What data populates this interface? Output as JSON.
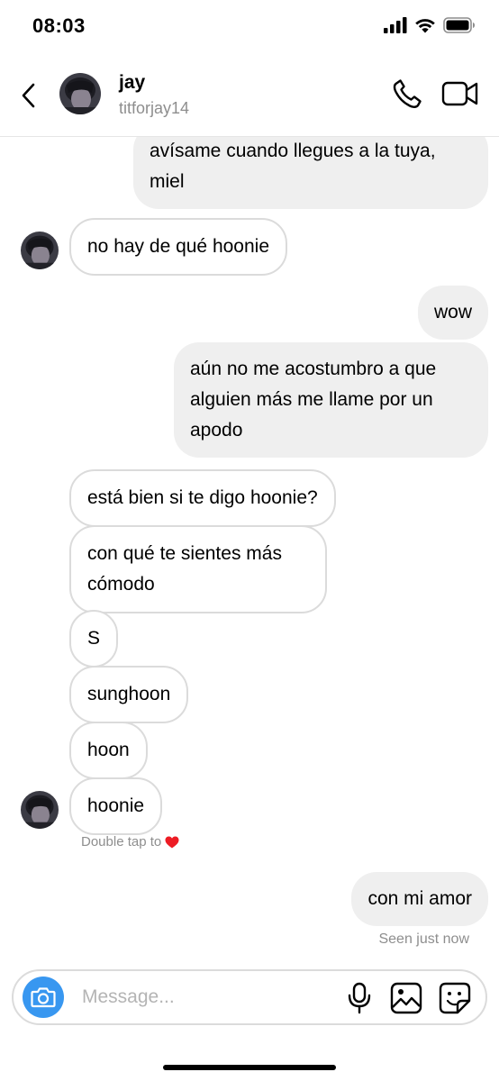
{
  "status_bar": {
    "time": "08:03"
  },
  "header": {
    "name": "jay",
    "handle": "titforjay14"
  },
  "messages": [
    {
      "direction": "outgoing",
      "text": "avísame cuando llegues a la tuya, miel"
    },
    {
      "direction": "incoming",
      "text": "no hay de qué hoonie"
    },
    {
      "direction": "outgoing",
      "text": "wow"
    },
    {
      "direction": "outgoing",
      "text": "aún no me acostumbro a que alguien más me llame por un apodo"
    },
    {
      "direction": "incoming",
      "text": "está bien si te digo hoonie?"
    },
    {
      "direction": "incoming",
      "text": "con qué te sientes más cómodo"
    },
    {
      "direction": "incoming",
      "text": "S"
    },
    {
      "direction": "incoming",
      "text": "sunghoon"
    },
    {
      "direction": "incoming",
      "text": "hoon"
    },
    {
      "direction": "incoming",
      "text": "hoonie"
    },
    {
      "direction": "outgoing",
      "text": "con mi amor"
    }
  ],
  "double_tap_hint": "Double tap to",
  "seen_status": "Seen just now",
  "composer": {
    "placeholder": "Message..."
  },
  "colors": {
    "accent": "#3897f0",
    "outgoing_bubble": "#efefef",
    "incoming_border": "#dbdbdb",
    "secondary_text": "#8e8e8e",
    "heart": "#ed1c24"
  },
  "icons": [
    "back-arrow-icon",
    "phone-icon",
    "video-camera-icon",
    "camera-icon",
    "microphone-icon",
    "gallery-icon",
    "sticker-icon",
    "heart-icon",
    "signal-icon",
    "wifi-icon",
    "battery-icon"
  ]
}
